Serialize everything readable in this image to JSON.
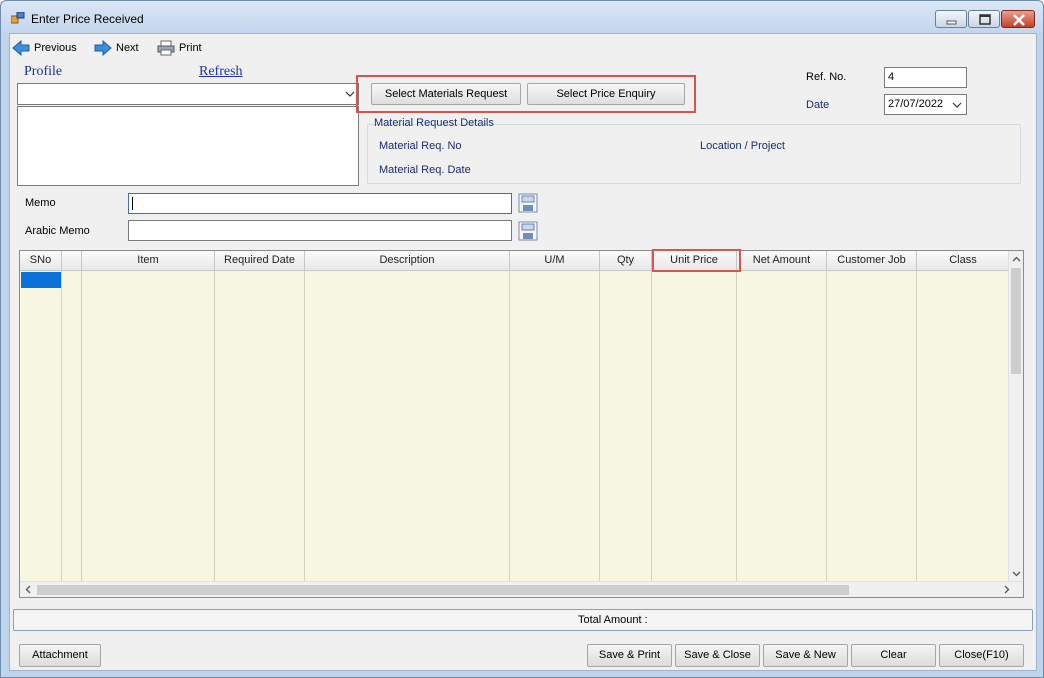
{
  "window": {
    "title": "Enter Price Received"
  },
  "toolbar": {
    "previous": "Previous",
    "next": "Next",
    "print": "Print"
  },
  "header": {
    "profile_label": "Profile",
    "refresh_label": "Refresh"
  },
  "buttons": {
    "select_materials_request": "Select Materials Request",
    "select_price_enquiry": "Select Price Enquiry"
  },
  "ref": {
    "label": "Ref. No.",
    "value": "4"
  },
  "date": {
    "label": "Date",
    "value": "27/07/2022"
  },
  "material_request": {
    "group_title": "Material Request Details",
    "req_no_label": "Material Req. No",
    "req_date_label": "Material Req. Date",
    "location_label": "Location / Project"
  },
  "memo": {
    "label": "Memo",
    "value": ""
  },
  "arabic_memo": {
    "label": "Arabic Memo",
    "value": ""
  },
  "grid": {
    "columns": [
      "SNo",
      "",
      "Item",
      "Required Date",
      "Description",
      "U/M",
      "Qty",
      "Unit Price",
      "Net Amount",
      "Customer Job",
      "Class"
    ]
  },
  "footer": {
    "total_label": "Total Amount :",
    "attachment": "Attachment",
    "save_print": "Save & Print",
    "save_close": "Save & Close",
    "save_new": "Save & New",
    "clear": "Clear",
    "close": "Close(F10)"
  },
  "colors": {
    "highlight_frame": "#d9534f",
    "grid_fill": "#f6f6e1",
    "selected_cell": "#0a72d8"
  },
  "icons": [
    "app-icon",
    "previous-arrow-icon",
    "next-arrow-icon",
    "printer-icon",
    "chevron-down-icon",
    "save-disk-icon"
  ]
}
